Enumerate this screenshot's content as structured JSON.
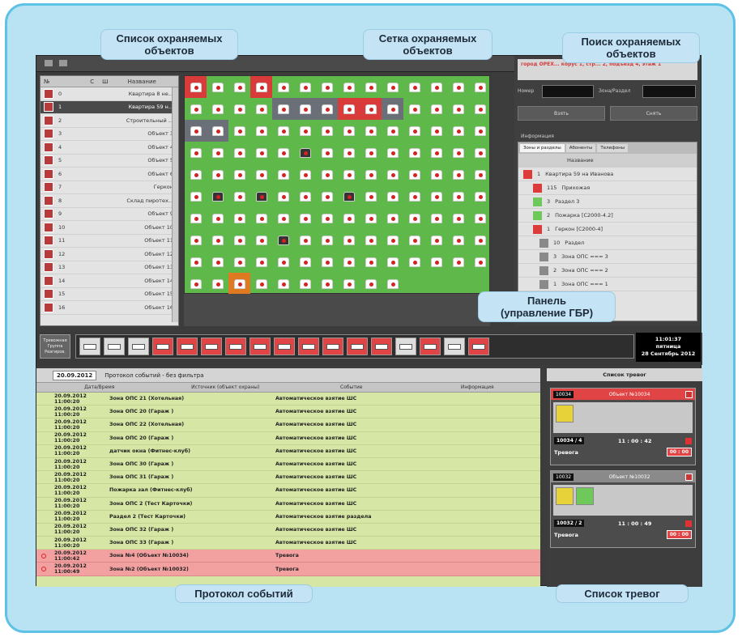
{
  "callouts": {
    "object_list": "Список охраняемых\nобъектов",
    "grid": "Сетка охраняемых\nобъектов",
    "search": "Поиск охраняемых\nобъектов",
    "panel": "Панель\n(управление ГБР)",
    "events": "Протокол событий",
    "alarms": "Список тревог"
  },
  "object_list": {
    "headers": [
      "№",
      "С",
      "Ш",
      "Название"
    ],
    "items": [
      {
        "num": "0",
        "name": "Квартира 8 не..."
      },
      {
        "num": "1",
        "name": "Квартира 59 н..."
      },
      {
        "num": "2",
        "name": "Строительный ..."
      },
      {
        "num": "3",
        "name": "Объект 3"
      },
      {
        "num": "4",
        "name": "Объект 4"
      },
      {
        "num": "5",
        "name": "Объект 5"
      },
      {
        "num": "6",
        "name": "Объект 6"
      },
      {
        "num": "7",
        "name": "Геркон"
      },
      {
        "num": "8",
        "name": "Склад пиротех..."
      },
      {
        "num": "9",
        "name": "Объект 9"
      },
      {
        "num": "10",
        "name": "Объект 10"
      },
      {
        "num": "11",
        "name": "Объект 11"
      },
      {
        "num": "12",
        "name": "Объект 12"
      },
      {
        "num": "13",
        "name": "Объект 13"
      },
      {
        "num": "14",
        "name": "Объект 14"
      },
      {
        "num": "15",
        "name": "Объект 15"
      },
      {
        "num": "16",
        "name": "Объект 16"
      }
    ]
  },
  "search": {
    "address": "город ОРЕХ... корус 1, стр... 2, подъезд 4, этаж 1",
    "number_label": "Номер",
    "zone_label": "Зона/Раздел",
    "arm_button": "Взять",
    "disarm_button": "Снять",
    "info_label": "Информация",
    "tabs": [
      "Зоны и разделы",
      "Абоненты",
      "Телефоны"
    ],
    "info_header": "Название",
    "info_rows": [
      {
        "num": "1",
        "name": "Квартира 59 на Иванова",
        "color": "#dd3a3a"
      },
      {
        "num": "115",
        "name": "Прихожая",
        "color": "#dd3a3a"
      },
      {
        "num": "3",
        "name": "Раздел 3",
        "color": "#6ec85a"
      },
      {
        "num": "2",
        "name": "Пожарка [С2000-4.2]",
        "color": "#6ec85a"
      },
      {
        "num": "1",
        "name": "Геркон [С2000-4]",
        "color": "#dd3a3a"
      },
      {
        "num": "10",
        "name": "Раздел",
        "color": "#8a8a8a"
      },
      {
        "num": "3",
        "name": "Зона ОПС === 3",
        "color": "#8a8a8a"
      },
      {
        "num": "2",
        "name": "Зона ОПС === 2",
        "color": "#8a8a8a"
      },
      {
        "num": "1",
        "name": "Зона ОПС === 1",
        "color": "#8a8a8a"
      }
    ]
  },
  "panel": {
    "button_label": "Тревожная\nГруппа\nРеагиров.",
    "clock_time": "11:01:37",
    "clock_day": "пятница",
    "clock_date": "28 Сентябрь 2012"
  },
  "events": {
    "date": "20.09.2012",
    "filter_label": "Протокол событий - без фильтра",
    "columns": [
      "Дата/Время",
      "Источник (объект охраны)",
      "Событие",
      "Информация"
    ],
    "rows": [
      {
        "time": "20.09.2012 11:00:20",
        "source": "Зона ОПС 21 (Хотельная)",
        "event": "Автоматическое взятие ШС"
      },
      {
        "time": "20.09.2012 11:00:20",
        "source": "Зона ОПС 20 (Гараж )",
        "event": "Автоматическое взятие ШС"
      },
      {
        "time": "20.09.2012 11:00:20",
        "source": "Зона ОПС 22 (Хотельная)",
        "event": "Автоматическое взятие ШС"
      },
      {
        "time": "20.09.2012 11:00:20",
        "source": "Зона ОПС 20 (Гараж )",
        "event": "Автоматическое взятие ШС"
      },
      {
        "time": "20.09.2012 11:00:20",
        "source": "датчик окна (Фитнес-клуб)",
        "event": "Автоматическое взятие ШС"
      },
      {
        "time": "20.09.2012 11:00:20",
        "source": "Зона ОПС 30 (Гараж )",
        "event": "Автоматическое взятие ШС"
      },
      {
        "time": "20.09.2012 11:00:20",
        "source": "Зона ОПС 31 (Гараж )",
        "event": "Автоматическое взятие ШС"
      },
      {
        "time": "20.09.2012 11:00:20",
        "source": "Пожарка зал (Фитнес-клуб)",
        "event": "Автоматическое взятие ШС"
      },
      {
        "time": "20.09.2012 11:00:20",
        "source": "Зона ОПС 2 (Тест Карточки)",
        "event": "Автоматическое взятие ШС"
      },
      {
        "time": "20.09.2012 11:00:20",
        "source": "Раздел 2 (Тест Карточки)",
        "event": "Автоматическое взятие раздела"
      },
      {
        "time": "20.09.2012 11:00:20",
        "source": "Зона ОПС 32 (Гараж )",
        "event": "Автоматическое взятие ШС"
      },
      {
        "time": "20.09.2012 11:00:20",
        "source": "Зона ОПС 33 (Гараж )",
        "event": "Автоматическое взятие ШС"
      },
      {
        "time": "20.09.2012 11:00:42",
        "source": "Зона №4 (Объект №10034)",
        "event": "Тревога",
        "alarm": true
      },
      {
        "time": "20.09.2012 11:00:49",
        "source": "Зона №2 (Объект №10032)",
        "event": "Тревога",
        "alarm": true
      }
    ]
  },
  "alarms": {
    "title": "Список тревог",
    "cards": [
      {
        "id": "10034",
        "object": "Объект №10034",
        "zone": "10034 / 4",
        "time": "11 : 00 : 42",
        "status": "Тревога",
        "elapsed": "00 : 00"
      },
      {
        "id": "10032",
        "object": "Объект №10032",
        "zone": "10032 / 2",
        "time": "11 : 00 : 49",
        "status": "Тревога",
        "elapsed": "00 : 00"
      }
    ]
  }
}
